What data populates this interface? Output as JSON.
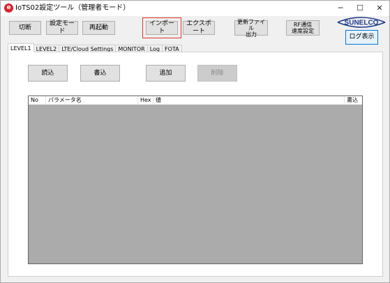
{
  "window": {
    "title": "IoTS02設定ツール（管理者モード）",
    "app_icon_glyph": "e",
    "controls": {
      "minimize": "─",
      "maximize": "☐",
      "close": "✕"
    }
  },
  "toolbar": {
    "disconnect": "切断",
    "settings_mode": "設定モード",
    "restart": "再起動",
    "import": "インポート",
    "export": "エクスポート",
    "update_file_output": "更新ファイル\n出力",
    "rf_speed_setting": "RF通信\n速度設定",
    "log_display": "ログ表示"
  },
  "logo": {
    "text": "SUNELCO",
    "accent": "#d9232e",
    "brand": "#1f3c8c"
  },
  "tabs": [
    {
      "label": "LEVEL1",
      "active": true
    },
    {
      "label": "LEVEL2"
    },
    {
      "label": "LTE/Cloud Settings"
    },
    {
      "label": "MONITOR"
    },
    {
      "label": "Log"
    },
    {
      "label": "FOTA"
    }
  ],
  "panel": {
    "read": "読込",
    "write": "書込",
    "add": "追加",
    "delete": "削除"
  },
  "table": {
    "headers": {
      "no": "No",
      "param_name": "パラメータ名",
      "hex": "Hex",
      "value": "値",
      "write": "書込"
    },
    "rows": []
  }
}
